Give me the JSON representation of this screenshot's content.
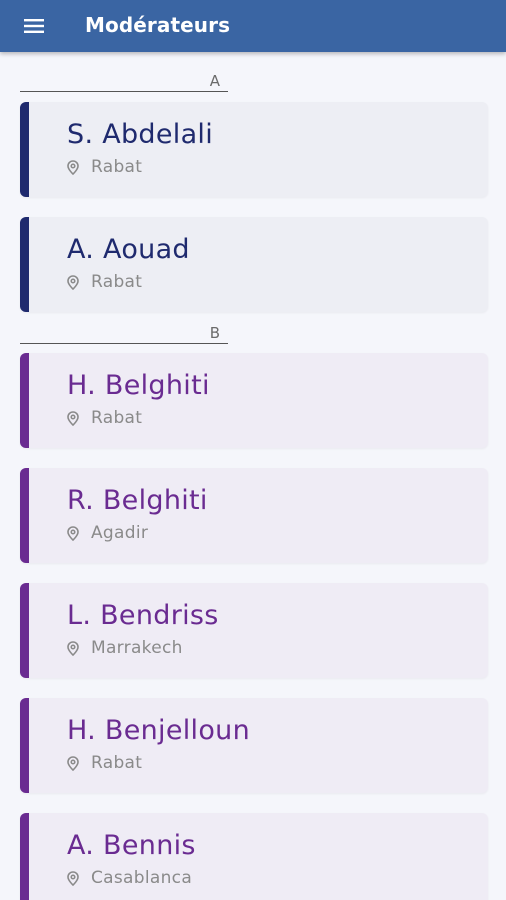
{
  "appbar": {
    "menu_icon": "hamburger-menu-icon",
    "title": "Modérateurs"
  },
  "theme": {
    "appbar_color": "#3a65a3",
    "group_a_accent": "#1f2a6e",
    "group_b_accent": "#6a2b91",
    "location_icon": "location-pin-icon"
  },
  "sections": [
    {
      "letter": "A",
      "moderators": [
        {
          "name": "S. Abdelali",
          "city": "Rabat"
        },
        {
          "name": "A. Aouad",
          "city": "Rabat"
        }
      ]
    },
    {
      "letter": "B",
      "moderators": [
        {
          "name": "H. Belghiti",
          "city": "Rabat"
        },
        {
          "name": "R. Belghiti",
          "city": "Agadir"
        },
        {
          "name": "L. Bendriss",
          "city": "Marrakech"
        },
        {
          "name": "H. Benjelloun",
          "city": "Rabat"
        },
        {
          "name": "A. Bennis",
          "city": "Casablanca"
        }
      ]
    }
  ]
}
